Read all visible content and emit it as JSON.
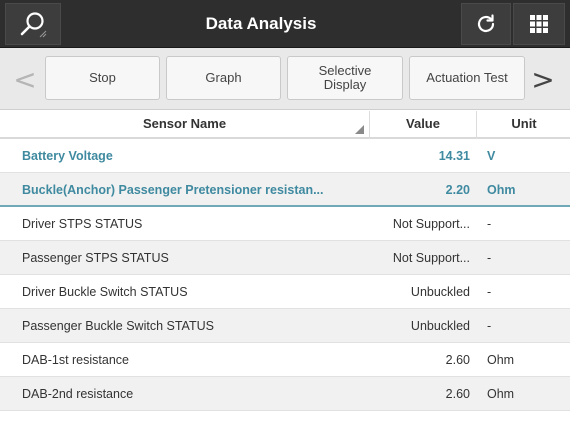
{
  "header": {
    "title": "Data Analysis",
    "search_icon": "search-icon",
    "refresh_icon": "refresh-icon",
    "grid_icon": "grid-menu-icon"
  },
  "toolbar": {
    "prev_arrow": "<",
    "next_arrow": ">",
    "stop_label": "Stop",
    "graph_label": "Graph",
    "selective_display_label": "Selective Display",
    "actuation_test_label": "Actuation Test"
  },
  "table": {
    "columns": {
      "name": "Sensor Name",
      "value": "Value",
      "unit": "Unit"
    },
    "rows": [
      {
        "name": "Battery Voltage",
        "value": "14.31",
        "unit": "V"
      },
      {
        "name": "Buckle(Anchor) Passenger Pretensioner resistan...",
        "value": "2.20",
        "unit": "Ohm"
      },
      {
        "name": "Driver STPS STATUS",
        "value": "Not Support...",
        "unit": "-"
      },
      {
        "name": "Passenger STPS STATUS",
        "value": "Not Support...",
        "unit": "-"
      },
      {
        "name": "Driver Buckle Switch STATUS",
        "value": "Unbuckled",
        "unit": "-"
      },
      {
        "name": "Passenger Buckle Switch STATUS",
        "value": "Unbuckled",
        "unit": "-"
      },
      {
        "name": "DAB-1st resistance",
        "value": "2.60",
        "unit": "Ohm"
      },
      {
        "name": "DAB-2nd resistance",
        "value": "2.60",
        "unit": "Ohm"
      }
    ]
  },
  "colors": {
    "header_bg": "#2e2e2e",
    "selected_text": "#3f8aa0",
    "toolbar_bg": "#e9e9e9"
  }
}
